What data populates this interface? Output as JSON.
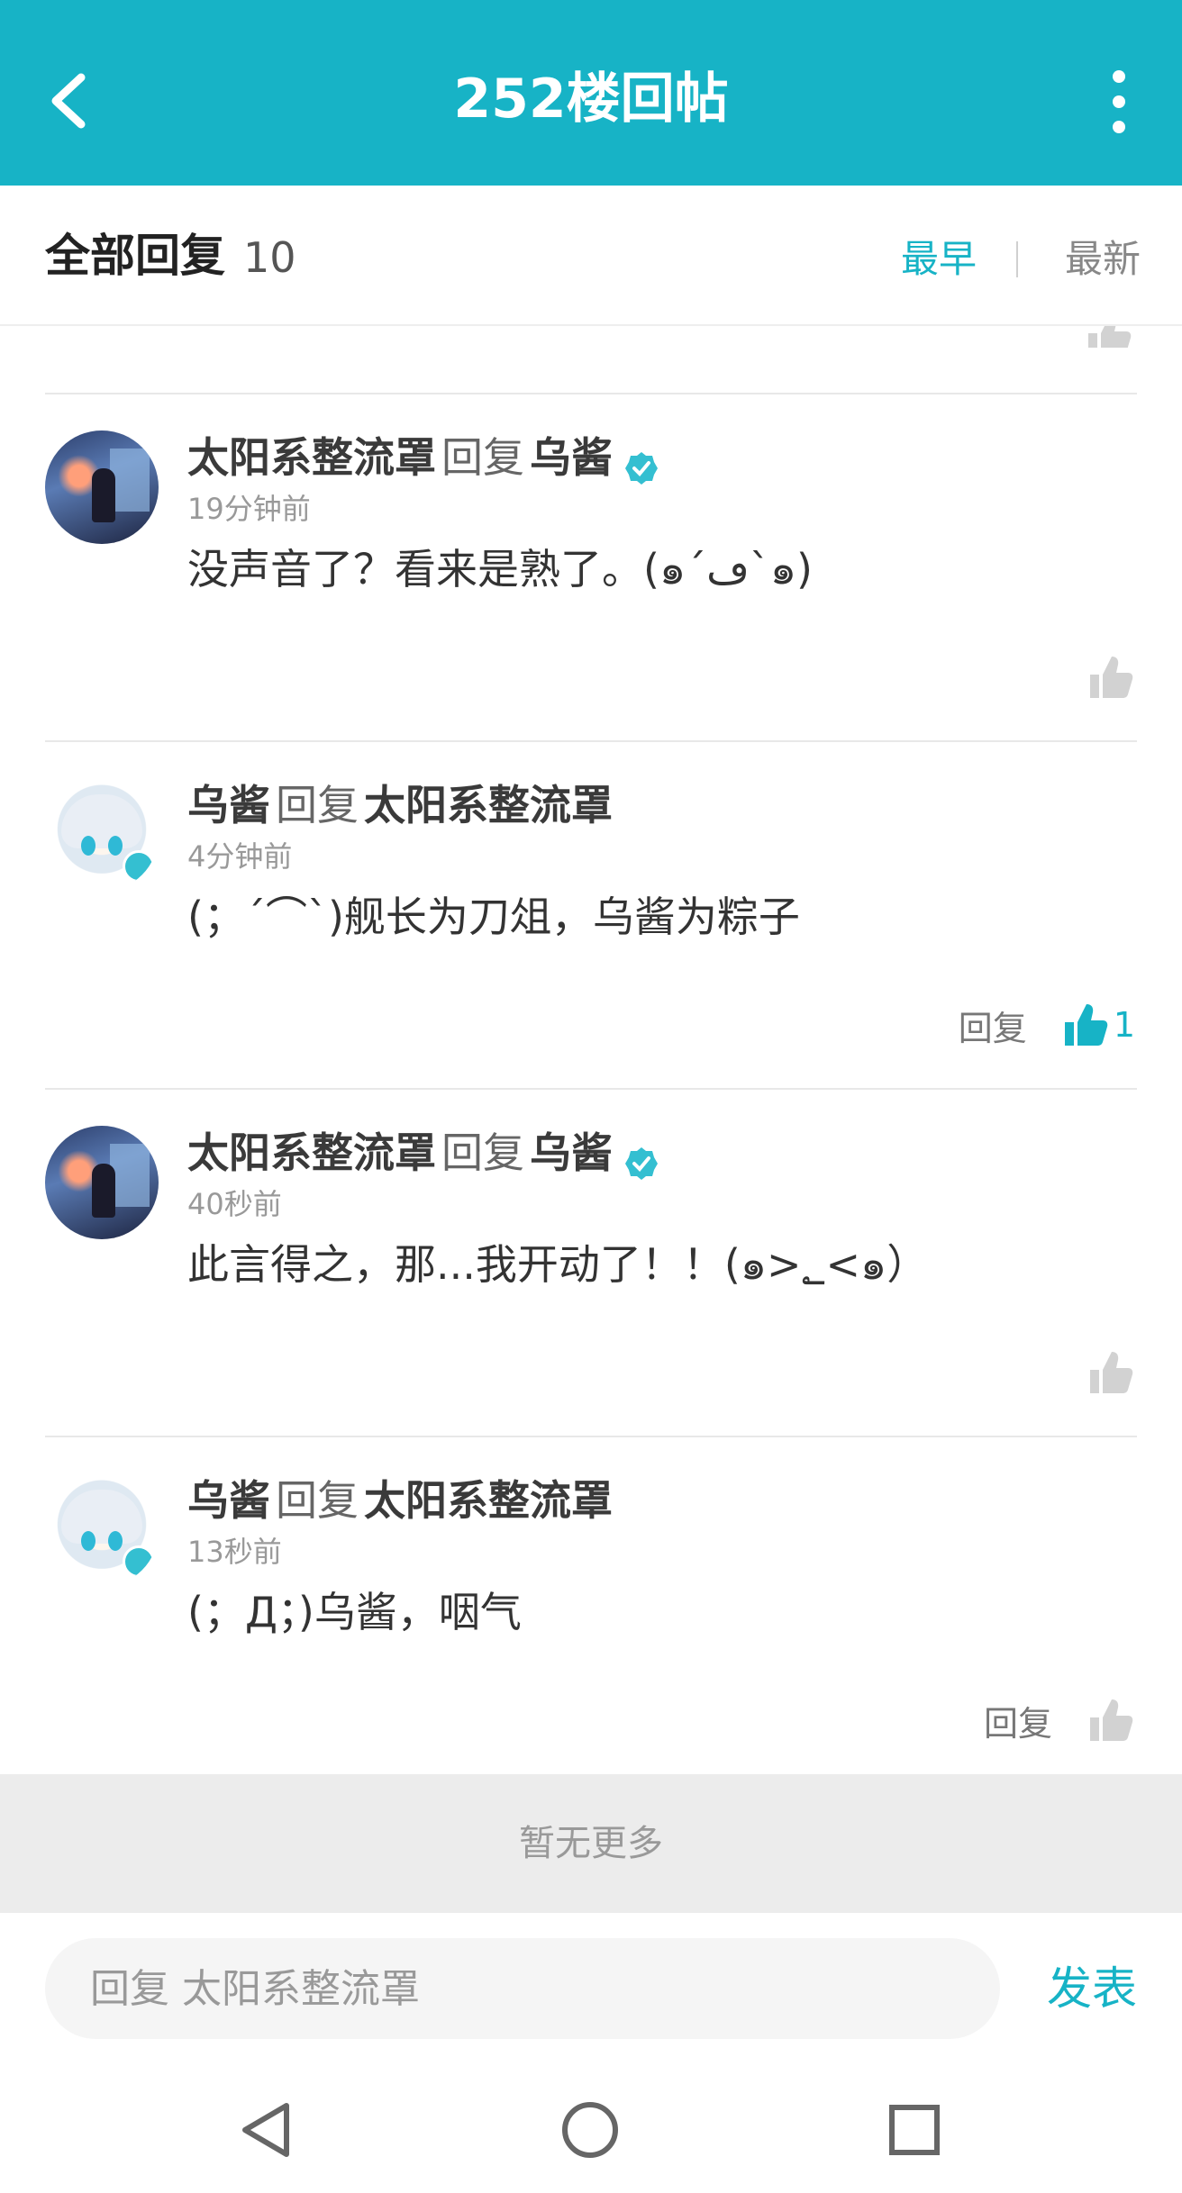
{
  "header": {
    "title": "252楼回帖",
    "back_icon": "chevron-left-icon",
    "more_icon": "more-vertical-icon"
  },
  "filter": {
    "label": "全部回复",
    "count": "10",
    "sort_earliest": "最早",
    "sort_latest": "最新"
  },
  "replies": [
    {
      "author": "太阳系整流罩",
      "verb": "回复",
      "target": "乌酱",
      "target_verified": true,
      "time": "19分钟前",
      "text": "没声音了？看来是熟了。(๑´ڡ`๑)",
      "show_reply": false,
      "liked": false,
      "likes": ""
    },
    {
      "author": "乌酱",
      "verb": "回复",
      "target": "太阳系整流罩",
      "target_verified": false,
      "time": "4分钟前",
      "text": "(；´⌒`)舰长为刀俎，乌酱为粽子",
      "show_reply": true,
      "reply_label": "回复",
      "liked": true,
      "likes": "1"
    },
    {
      "author": "太阳系整流罩",
      "verb": "回复",
      "target": "乌酱",
      "target_verified": true,
      "time": "40秒前",
      "text": "此言得之，那...我开动了！！(๑>؂<๑）",
      "show_reply": false,
      "liked": false,
      "likes": ""
    },
    {
      "author": "乌酱",
      "verb": "回复",
      "target": "太阳系整流罩",
      "target_verified": false,
      "time": "13秒前",
      "text": "(；Д；)乌酱，咽气",
      "show_reply": true,
      "reply_label": "回复",
      "liked": false,
      "likes": ""
    }
  ],
  "no_more": "暂无更多",
  "composer": {
    "placeholder": "回复 太阳系整流罩",
    "send_label": "发表"
  },
  "colors": {
    "accent": "#17b3c6",
    "like_gray": "#d2d2d2"
  }
}
